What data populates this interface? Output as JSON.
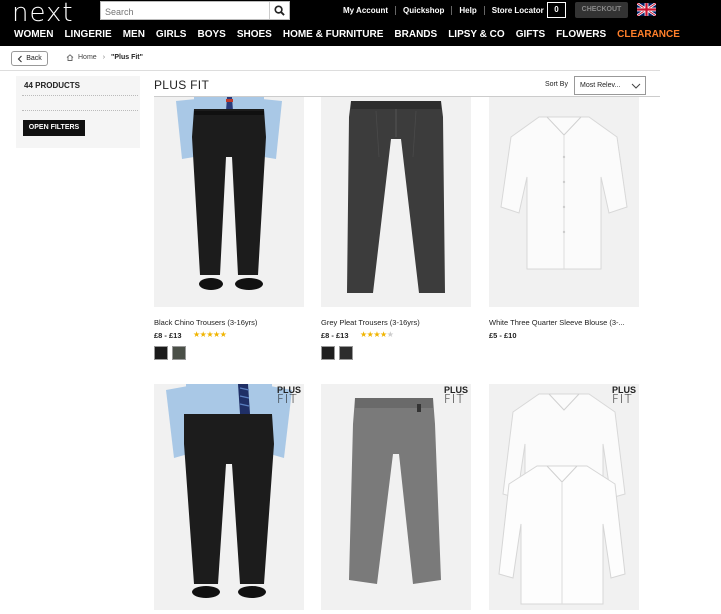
{
  "header": {
    "logo": "next",
    "search_placeholder": "Search",
    "utility_links": [
      "My Account",
      "Quickshop",
      "Help",
      "Store Locator"
    ],
    "bag_count": "0",
    "checkout_label": "CHECKOUT"
  },
  "nav": {
    "items": [
      "WOMEN",
      "LINGERIE",
      "MEN",
      "GIRLS",
      "BOYS",
      "SHOES",
      "HOME & FURNITURE",
      "BRANDS",
      "LIPSY & CO",
      "GIFTS",
      "FLOWERS",
      "CLEARANCE"
    ],
    "highlight_color": "#ff7f2a"
  },
  "breadcrumb": {
    "back_label": "Back",
    "home_label": "Home",
    "current_label": "\"Plus Fit\""
  },
  "sidebar": {
    "product_count": "44 PRODUCTS",
    "open_filters_label": "OPEN FILTERS"
  },
  "main": {
    "title": "PLUS FIT",
    "sort_label": "Sort By",
    "sort_value": "Most Relev..."
  },
  "badge": {
    "plus": "PLUS",
    "fit": "FIT"
  },
  "products": [
    {
      "name": "Black Chino Trousers (3-16yrs)",
      "price": "£8 - £13",
      "rating": 5,
      "swatch_colors": [
        "#1a1a1a",
        "#4a4f47"
      ]
    },
    {
      "name": "Grey Pleat Trousers (3-16yrs)",
      "price": "£8 - £13",
      "rating": 4,
      "swatch_colors": [
        "#1e1e1e",
        "#2c2c2c"
      ]
    },
    {
      "name": "White Three Quarter Sleeve Blouse (3-...",
      "price": "£5 - £10",
      "rating": 0,
      "swatch_colors": []
    }
  ]
}
